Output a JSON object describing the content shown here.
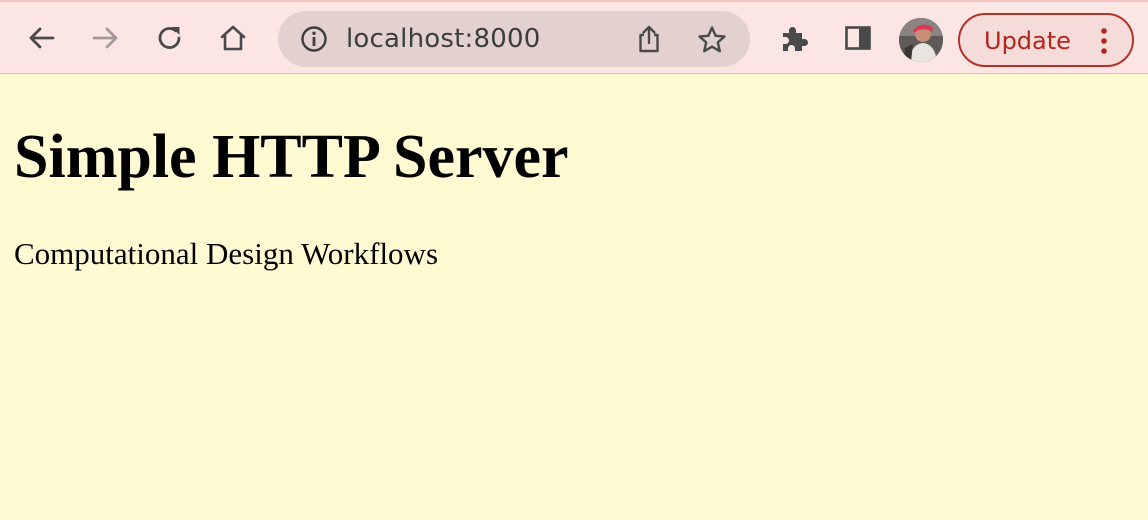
{
  "browser": {
    "address_bar": {
      "url": "localhost:8000"
    },
    "update_button": {
      "label": "Update"
    },
    "icons": {
      "back": "back-arrow-icon",
      "forward": "forward-arrow-icon",
      "reload": "reload-icon",
      "home": "home-icon",
      "site_info": "info-icon",
      "share": "share-icon",
      "bookmark": "star-icon",
      "extensions": "puzzle-icon",
      "side_panel": "side-panel-icon",
      "menu": "three-dots-vertical-icon"
    }
  },
  "page": {
    "heading": "Simple HTTP Server",
    "subtitle": "Computational Design Workflows"
  },
  "colors": {
    "page_background": "#fffad2",
    "toolbar_background": "#fbe6e4",
    "update_accent": "#b3261e"
  }
}
